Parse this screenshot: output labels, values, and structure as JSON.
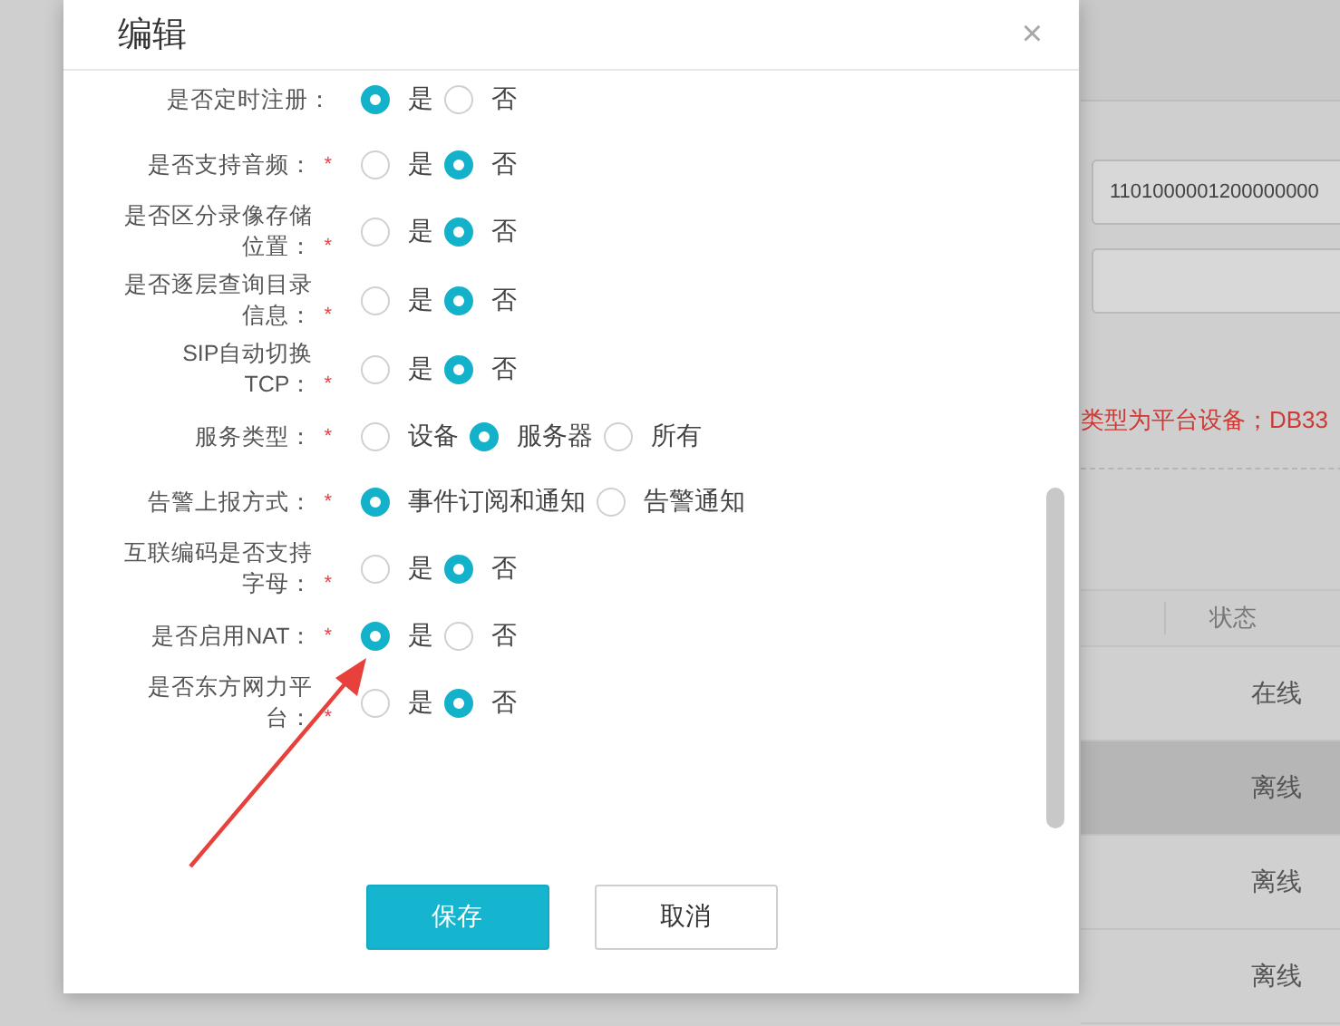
{
  "background": {
    "code_field": {
      "value": "1101000001200000000"
    },
    "notice": "类型为平台设备；DB33",
    "table": {
      "column": "状态",
      "rows": [
        {
          "status": "在线",
          "highlighted": false
        },
        {
          "status": "离线",
          "highlighted": true
        },
        {
          "status": "离线",
          "highlighted": false
        },
        {
          "status": "离线",
          "highlighted": false
        }
      ]
    }
  },
  "dialog": {
    "title": "编辑",
    "close": "×",
    "rows": [
      {
        "label": "是否定时注册：",
        "required": false,
        "options": [
          {
            "label": "是",
            "selected": true
          },
          {
            "label": "否",
            "selected": false
          }
        ]
      },
      {
        "label": "是否支持音频：",
        "required": true,
        "options": [
          {
            "label": "是",
            "selected": false
          },
          {
            "label": "否",
            "selected": true
          }
        ]
      },
      {
        "label": "是否区分录像存储位置：",
        "required": true,
        "options": [
          {
            "label": "是",
            "selected": false
          },
          {
            "label": "否",
            "selected": true
          }
        ]
      },
      {
        "label": "是否逐层查询目录信息：",
        "required": true,
        "options": [
          {
            "label": "是",
            "selected": false
          },
          {
            "label": "否",
            "selected": true
          }
        ]
      },
      {
        "label": "SIP自动切换TCP：",
        "required": true,
        "options": [
          {
            "label": "是",
            "selected": false
          },
          {
            "label": "否",
            "selected": true
          }
        ]
      },
      {
        "label": "服务类型：",
        "required": true,
        "options": [
          {
            "label": "设备",
            "selected": false
          },
          {
            "label": "服务器",
            "selected": true
          },
          {
            "label": "所有",
            "selected": false
          }
        ]
      },
      {
        "label": "告警上报方式：",
        "required": true,
        "options": [
          {
            "label": "事件订阅和通知",
            "selected": true
          },
          {
            "label": "告警通知",
            "selected": false
          }
        ]
      },
      {
        "label": "互联编码是否支持字母：",
        "required": true,
        "options": [
          {
            "label": "是",
            "selected": false
          },
          {
            "label": "否",
            "selected": true
          }
        ]
      },
      {
        "label": "是否启用NAT：",
        "required": true,
        "options": [
          {
            "label": "是",
            "selected": true
          },
          {
            "label": "否",
            "selected": false
          }
        ]
      },
      {
        "label": "是否东方网力平台：",
        "required": true,
        "options": [
          {
            "label": "是",
            "selected": false
          },
          {
            "label": "否",
            "selected": true
          }
        ]
      }
    ],
    "required_mark": "*",
    "buttons": [
      {
        "label": "保存",
        "kind": "primary"
      },
      {
        "label": "取消",
        "kind": "default"
      }
    ]
  }
}
